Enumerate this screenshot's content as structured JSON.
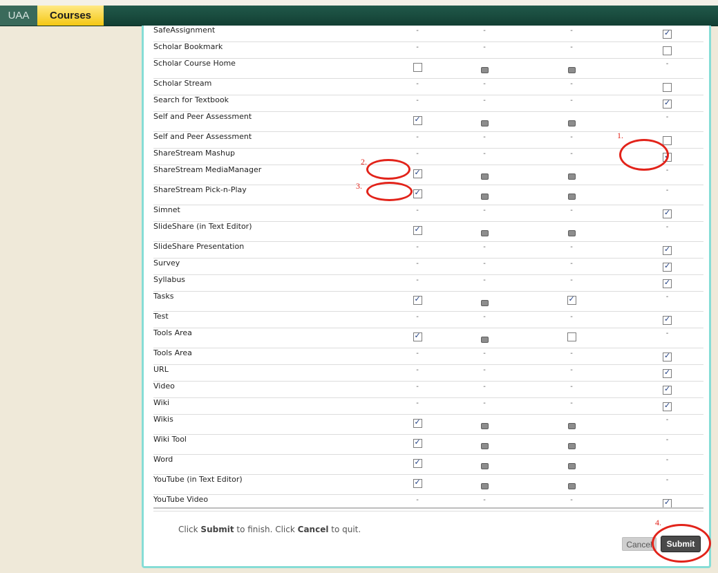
{
  "nav": {
    "home": "UAA",
    "courses": "Courses"
  },
  "symbols": {
    "dash": "-"
  },
  "rows": [
    {
      "name": "SafeAssignment",
      "h": "short",
      "cells": [
        "dash",
        "dash",
        "dash",
        "on"
      ]
    },
    {
      "name": "Scholar Bookmark",
      "h": "short",
      "cells": [
        "dash",
        "dash",
        "dash",
        "off"
      ]
    },
    {
      "name": "Scholar Course Home",
      "h": "tall",
      "cells": [
        "off",
        "lock",
        "lock",
        "dash"
      ]
    },
    {
      "name": "Scholar Stream",
      "h": "short",
      "cells": [
        "dash",
        "dash",
        "dash",
        "off"
      ]
    },
    {
      "name": "Search for Textbook",
      "h": "short",
      "cells": [
        "dash",
        "dash",
        "dash",
        "on"
      ]
    },
    {
      "name": "Self and Peer Assessment",
      "h": "tall",
      "cells": [
        "on",
        "lock",
        "lock",
        "dash"
      ]
    },
    {
      "name": "Self and Peer Assessment",
      "h": "short",
      "cells": [
        "dash",
        "dash",
        "dash",
        "off"
      ]
    },
    {
      "name": "ShareStream Mashup",
      "h": "short",
      "cells": [
        "dash",
        "dash",
        "dash",
        "on"
      ]
    },
    {
      "name": "ShareStream MediaManager",
      "h": "tall",
      "cells": [
        "on",
        "lock",
        "lock",
        "dash"
      ]
    },
    {
      "name": "ShareStream Pick-n-Play",
      "h": "tall",
      "cells": [
        "on",
        "lock",
        "lock",
        "dash"
      ]
    },
    {
      "name": "Simnet",
      "h": "short",
      "cells": [
        "dash",
        "dash",
        "dash",
        "on"
      ]
    },
    {
      "name": "SlideShare (in Text Editor)",
      "h": "tall",
      "cells": [
        "on",
        "lock",
        "lock",
        "dash"
      ]
    },
    {
      "name": "SlideShare Presentation",
      "h": "short",
      "cells": [
        "dash",
        "dash",
        "dash",
        "on"
      ]
    },
    {
      "name": "Survey",
      "h": "short",
      "cells": [
        "dash",
        "dash",
        "dash",
        "on"
      ]
    },
    {
      "name": "Syllabus",
      "h": "short",
      "cells": [
        "dash",
        "dash",
        "dash",
        "on"
      ]
    },
    {
      "name": "Tasks",
      "h": "tall",
      "cells": [
        "on",
        "lock",
        "on",
        "dash"
      ]
    },
    {
      "name": "Test",
      "h": "short",
      "cells": [
        "dash",
        "dash",
        "dash",
        "on"
      ]
    },
    {
      "name": "Tools Area",
      "h": "tall",
      "cells": [
        "on",
        "lock",
        "off",
        "dash"
      ]
    },
    {
      "name": "Tools Area",
      "h": "short",
      "cells": [
        "dash",
        "dash",
        "dash",
        "on"
      ]
    },
    {
      "name": "URL",
      "h": "short",
      "cells": [
        "dash",
        "dash",
        "dash",
        "on"
      ]
    },
    {
      "name": "Video",
      "h": "short",
      "cells": [
        "dash",
        "dash",
        "dash",
        "on"
      ]
    },
    {
      "name": "Wiki",
      "h": "short",
      "cells": [
        "dash",
        "dash",
        "dash",
        "on"
      ]
    },
    {
      "name": "Wikis",
      "h": "tall",
      "cells": [
        "on",
        "lock",
        "lock",
        "dash"
      ]
    },
    {
      "name": "Wiki Tool",
      "h": "tall",
      "cells": [
        "on",
        "lock",
        "lock",
        "dash"
      ]
    },
    {
      "name": "Word",
      "h": "tall",
      "cells": [
        "on",
        "lock",
        "lock",
        "dash"
      ]
    },
    {
      "name": "YouTube (in Text Editor)",
      "h": "tall",
      "cells": [
        "on",
        "lock",
        "lock",
        "dash"
      ]
    },
    {
      "name": "YouTube Video",
      "h": "short",
      "cells": [
        "dash",
        "dash",
        "dash",
        "on"
      ]
    }
  ],
  "footer": {
    "instr_pre": "Click ",
    "instr_submit": "Submit",
    "instr_mid": " to finish. Click ",
    "instr_cancel": "Cancel",
    "instr_post": " to quit.",
    "cancel_label": "Cancel",
    "submit_label": "Submit"
  },
  "annotations": {
    "a1": "1.",
    "a2": "2.",
    "a3": "3.",
    "a4": "4."
  },
  "colors": {
    "nav_bg": "#1b4d40",
    "courses_tab": "#f4c712",
    "panel_border": "#86ddd6",
    "annotation": "#e2231a"
  }
}
